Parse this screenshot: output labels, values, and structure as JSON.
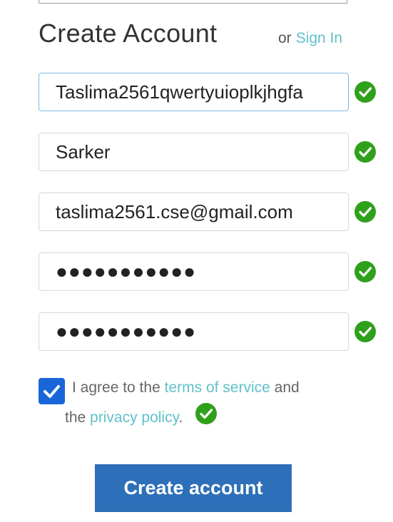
{
  "form": {
    "title": "Create Account",
    "or_text": "or",
    "signin_label": "Sign In",
    "first_name_value": "Taslima2561qwertyuioplkjhgfa",
    "last_name_value": "Sarker",
    "email_value": "taslima2561.cse@gmail.com",
    "password_display": "●●●●●●●●●●●",
    "confirm_password_display": "●●●●●●●●●●●",
    "agree_prefix": "I agree to the",
    "terms_label": "terms of service",
    "agree_and": "and",
    "the_text": "the",
    "privacy_label": "privacy policy",
    "period": ".",
    "agree_checked": true,
    "submit_label": "Create account"
  },
  "icons": {
    "valid": "check-circle-icon",
    "checkbox_check": "checkmark-icon"
  },
  "colors": {
    "link": "#5fc1c9",
    "valid_green": "#2fa01c",
    "checkbox_blue": "#1a66d8",
    "button_blue": "#2d6fb8",
    "focus_border": "#7fb7df"
  }
}
